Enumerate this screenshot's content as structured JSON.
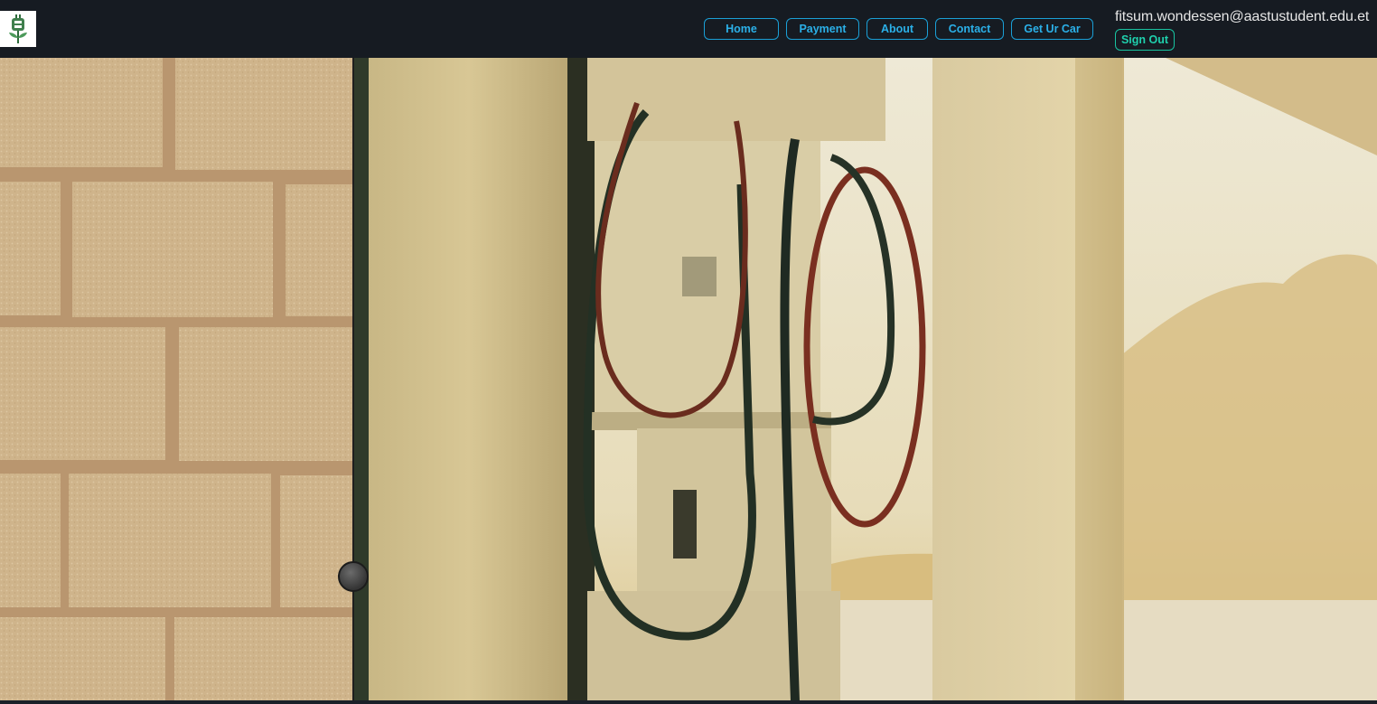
{
  "header": {
    "logo_icon": "plug-charger-logo-icon",
    "nav": [
      {
        "label": "Home"
      },
      {
        "label": "Payment"
      },
      {
        "label": "About"
      },
      {
        "label": "Contact"
      },
      {
        "label": "Get Ur Car"
      }
    ],
    "user_email": "fitsum.wondessen@aastustudent.edu.et",
    "sign_out_label": "Sign Out"
  },
  "hero": {
    "left_image": "brick-wall-photo",
    "right_image": "vintage-gas-pump-photo",
    "comparison_split_fraction": 0.256
  },
  "colors": {
    "header_bg": "#161b22",
    "nav_accent": "#1a9fd6",
    "signout_accent": "#18c3a0"
  }
}
